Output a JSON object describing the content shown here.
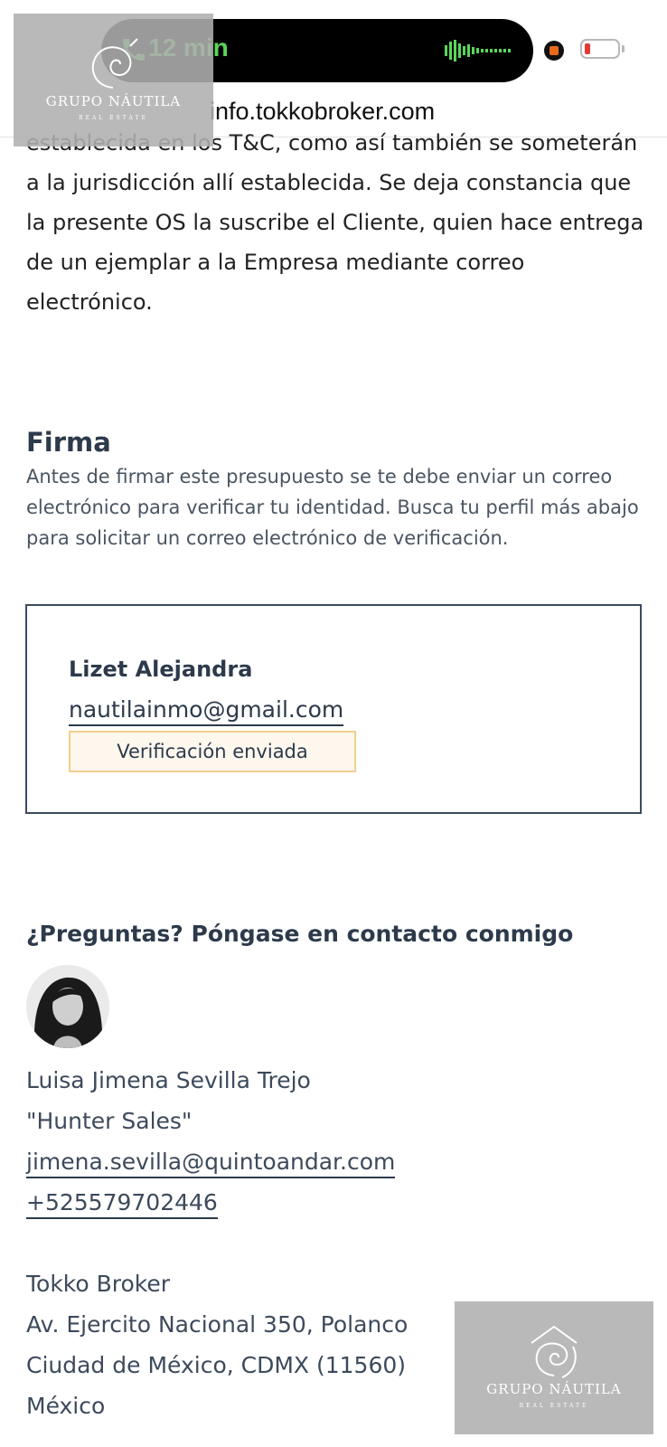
{
  "status_bar": {
    "call_duration": "12 min",
    "url": "info.tokkobroker.com"
  },
  "watermark": {
    "brand": "GRUPO NÁUTILA",
    "tagline": "REAL ESTATE"
  },
  "terms": {
    "text": "establecida en los T&C, como así también se someterán a la jurisdicción allí establecida. Se deja constancia que la presente OS la suscribe el Cliente, quien hace entrega de un ejemplar a la Empresa mediante correo electrónico."
  },
  "signature": {
    "title": "Firma",
    "intro": "Antes de firmar este presupuesto se te debe enviar un correo electrónico para verificar tu identidad. Busca tu perfil más abajo para solicitar un correo electrónico de verificación.",
    "signer": {
      "name": "Lizet Alejandra",
      "email": "nautilainmo@gmail.com",
      "status": "Verificación enviada"
    }
  },
  "contact": {
    "title": "¿Preguntas? Póngase en contacto conmigo",
    "name": "Luisa Jimena Sevilla Trejo",
    "role": "\"Hunter Sales\"",
    "email": "jimena.sevilla@quintoandar.com",
    "phone": "+525579702446",
    "company": "Tokko Broker",
    "address_line1": "Av. Ejercito Nacional 350, Polanco",
    "address_line2": "Ciudad de México, CDMX (11560)",
    "country": "México"
  },
  "colors": {
    "text_primary": "#2d3a4b",
    "call_green": "#5ad65a",
    "badge_border": "#f2cf8f",
    "badge_bg": "#fdf7ee"
  }
}
